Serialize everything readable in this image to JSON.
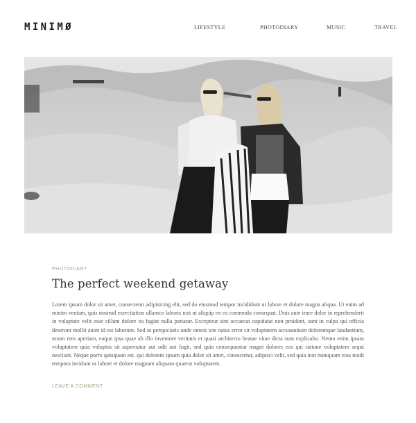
{
  "header": {
    "logo": "MINIMØ",
    "nav": [
      "LIFESTYLE",
      "PHOTODIARY",
      "MUSIC",
      "TRAVEL"
    ]
  },
  "post": {
    "category": "PHOTODIARY",
    "title": "The perfect weekend getaway",
    "body": "Lorem ipsum dolor sit amet, consectetur adipisicing elit, sed do eiusmod tempor incididunt ut labore et dolore magna aliqua. Ut enim ad minim veniam, quis nostrud exercitation ullamco laboris nisi ut aliquip ex ea commodo consequat. Duis aute irure dolor in reprehenderit in voluptate velit esse cillum dolore eu fugiat nulla pariatur. Excepteur sint occaecat cupidatat non proident, sunt in culpa qui officia deserunt mollit anim id est laborum. Sed ut perspiciatis unde omnis iste natus error sit voluptatem accusantium doloremque laudantium, totam rem aperiam, eaque ipsa quae ab illo inventore veritatis et quasi architecto beatae vitae dicta sunt explicabo. Nemo enim ipsam voluptatem quia voluptas sit aspernatur aut odit aut fugit, sed quia consequuntur magni dolores eos qui ratione voluptatem sequi nesciunt. Neque porro quisquam est, qui dolorem ipsum quia dolor sit amet, consectetur, adipisci velit, sed quia non numquam eius modi tempora incidunt ut labore et dolore magnam aliquam quaerat voluptatem.",
    "comment_link": "LEAVE A COMMENT"
  },
  "colors": {
    "accent": "#a9a38a",
    "text": "#333333",
    "body_text": "#555555"
  }
}
